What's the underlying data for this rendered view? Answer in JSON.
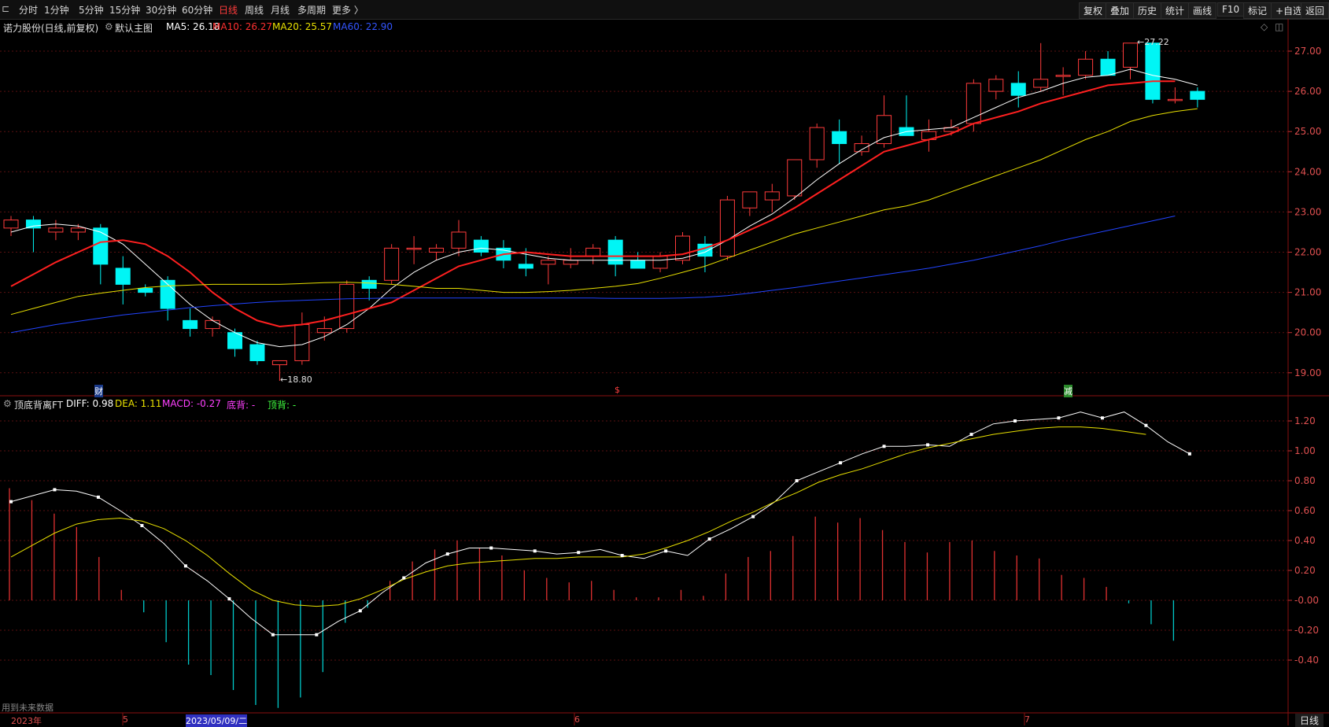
{
  "toolbar": {
    "periods": [
      "分时",
      "1分钟",
      "5分钟",
      "15分钟",
      "30分钟",
      "60分钟",
      "日线",
      "周线",
      "月线",
      "多周期",
      "更多 〉"
    ],
    "active_period": "日线",
    "right_buttons": [
      "复权",
      "叠加",
      "历史",
      "统计",
      "画线",
      "F10",
      "标记",
      "+自选",
      "返回"
    ]
  },
  "main_chart": {
    "stock_title": "诺力股份(日线,前复权)",
    "template_label": "默认主图",
    "indicators": [
      {
        "label": "MA5: 26.18",
        "color": "#ffffff"
      },
      {
        "label": "MA10: 26.27",
        "color": "#ff3030"
      },
      {
        "label": "MA20: 25.57",
        "color": "#e8e000"
      },
      {
        "label": "MA60: 22.90",
        "color": "#3355ff"
      }
    ],
    "high_marker": "27.22",
    "low_marker": "18.80",
    "event_markers": [
      "财",
      "$",
      "减"
    ]
  },
  "sub_chart": {
    "indicator_name": "顶底背离FT",
    "values": [
      {
        "label": "DIFF: 0.98",
        "color": "#ffffff"
      },
      {
        "label": "DEA: 1.11",
        "color": "#e8e000"
      },
      {
        "label": "MACD: -0.27",
        "color": "#ff40ff"
      },
      {
        "label": "底背: -",
        "color": "#ff40ff"
      },
      {
        "label": "顶背: -",
        "color": "#40ff40"
      }
    ]
  },
  "footer": {
    "future_data_label": "用到未来数据",
    "date_labels": [
      "2023年",
      "5",
      "2023/05/09/二",
      "6",
      "7"
    ],
    "period_badge": "日线"
  },
  "chart_data": [
    {
      "type": "candlestick",
      "title": "诺力股份(日线,前复权)",
      "ylim": [
        18.5,
        27.3
      ],
      "y_ticks": [
        19.0,
        20.0,
        21.0,
        22.0,
        23.0,
        24.0,
        25.0,
        26.0,
        27.0
      ],
      "candles": [
        {
          "o": 22.6,
          "h": 22.9,
          "l": 22.4,
          "c": 22.8
        },
        {
          "o": 22.8,
          "h": 22.9,
          "l": 22.0,
          "c": 22.6
        },
        {
          "o": 22.5,
          "h": 22.8,
          "l": 22.3,
          "c": 22.6
        },
        {
          "o": 22.5,
          "h": 22.7,
          "l": 22.3,
          "c": 22.6
        },
        {
          "o": 22.6,
          "h": 22.7,
          "l": 21.2,
          "c": 21.7
        },
        {
          "o": 21.6,
          "h": 21.9,
          "l": 20.7,
          "c": 21.2
        },
        {
          "o": 21.1,
          "h": 21.2,
          "l": 20.9,
          "c": 21.0
        },
        {
          "o": 21.3,
          "h": 21.4,
          "l": 20.3,
          "c": 20.6
        },
        {
          "o": 20.3,
          "h": 20.6,
          "l": 19.9,
          "c": 20.1
        },
        {
          "o": 20.1,
          "h": 20.4,
          "l": 19.9,
          "c": 20.3
        },
        {
          "o": 20.0,
          "h": 20.1,
          "l": 19.4,
          "c": 19.6
        },
        {
          "o": 19.7,
          "h": 19.8,
          "l": 19.2,
          "c": 19.3
        },
        {
          "o": 19.2,
          "h": 19.3,
          "l": 18.8,
          "c": 19.3
        },
        {
          "o": 19.3,
          "h": 20.5,
          "l": 19.2,
          "c": 20.2
        },
        {
          "o": 20.0,
          "h": 20.4,
          "l": 19.8,
          "c": 20.1
        },
        {
          "o": 20.1,
          "h": 21.3,
          "l": 20.0,
          "c": 21.2
        },
        {
          "o": 21.3,
          "h": 21.4,
          "l": 20.8,
          "c": 21.1
        },
        {
          "o": 21.3,
          "h": 22.2,
          "l": 21.2,
          "c": 22.1
        },
        {
          "o": 22.1,
          "h": 22.4,
          "l": 21.7,
          "c": 22.1
        },
        {
          "o": 22.0,
          "h": 22.2,
          "l": 21.8,
          "c": 22.1
        },
        {
          "o": 22.1,
          "h": 22.8,
          "l": 21.9,
          "c": 22.5
        },
        {
          "o": 22.3,
          "h": 22.4,
          "l": 21.9,
          "c": 22.0
        },
        {
          "o": 22.1,
          "h": 22.3,
          "l": 21.6,
          "c": 21.8
        },
        {
          "o": 21.7,
          "h": 22.1,
          "l": 21.4,
          "c": 21.6
        },
        {
          "o": 21.7,
          "h": 21.9,
          "l": 21.2,
          "c": 21.8
        },
        {
          "o": 21.7,
          "h": 22.1,
          "l": 21.6,
          "c": 21.8
        },
        {
          "o": 21.9,
          "h": 22.2,
          "l": 21.7,
          "c": 22.1
        },
        {
          "o": 22.3,
          "h": 22.4,
          "l": 21.4,
          "c": 21.7
        },
        {
          "o": 21.8,
          "h": 22.0,
          "l": 21.6,
          "c": 21.6
        },
        {
          "o": 21.6,
          "h": 22.0,
          "l": 21.5,
          "c": 21.9
        },
        {
          "o": 21.8,
          "h": 22.5,
          "l": 21.7,
          "c": 22.4
        },
        {
          "o": 22.2,
          "h": 22.4,
          "l": 21.5,
          "c": 21.9
        },
        {
          "o": 21.9,
          "h": 23.4,
          "l": 21.8,
          "c": 23.3
        },
        {
          "o": 23.1,
          "h": 23.5,
          "l": 22.9,
          "c": 23.5
        },
        {
          "o": 23.3,
          "h": 23.7,
          "l": 23.0,
          "c": 23.5
        },
        {
          "o": 23.4,
          "h": 24.3,
          "l": 23.3,
          "c": 24.3
        },
        {
          "o": 24.3,
          "h": 25.2,
          "l": 24.1,
          "c": 25.1
        },
        {
          "o": 25.0,
          "h": 25.3,
          "l": 24.2,
          "c": 24.7
        },
        {
          "o": 24.5,
          "h": 24.9,
          "l": 24.4,
          "c": 24.7
        },
        {
          "o": 24.7,
          "h": 25.9,
          "l": 24.6,
          "c": 25.4
        },
        {
          "o": 25.1,
          "h": 25.9,
          "l": 24.9,
          "c": 24.9
        },
        {
          "o": 24.8,
          "h": 25.3,
          "l": 24.5,
          "c": 25.0
        },
        {
          "o": 25.0,
          "h": 25.3,
          "l": 24.9,
          "c": 25.1
        },
        {
          "o": 25.2,
          "h": 26.3,
          "l": 25.0,
          "c": 26.2
        },
        {
          "o": 26.0,
          "h": 26.4,
          "l": 25.8,
          "c": 26.3
        },
        {
          "o": 26.2,
          "h": 26.5,
          "l": 25.6,
          "c": 25.9
        },
        {
          "o": 26.1,
          "h": 27.2,
          "l": 26.0,
          "c": 26.3
        },
        {
          "o": 26.4,
          "h": 26.6,
          "l": 25.9,
          "c": 26.4
        },
        {
          "o": 26.4,
          "h": 27.0,
          "l": 26.3,
          "c": 26.8
        },
        {
          "o": 26.8,
          "h": 27.0,
          "l": 26.4,
          "c": 26.4
        },
        {
          "o": 26.6,
          "h": 27.2,
          "l": 26.3,
          "c": 27.2
        },
        {
          "o": 27.2,
          "h": 27.2,
          "l": 25.7,
          "c": 25.8
        },
        {
          "o": 25.8,
          "h": 26.1,
          "l": 25.7,
          "c": 25.8
        },
        {
          "o": 26.0,
          "h": 26.1,
          "l": 25.6,
          "c": 25.8
        }
      ],
      "series": [
        {
          "name": "MA5",
          "color": "#ffffff",
          "width": 1,
          "values": [
            22.5,
            22.65,
            22.7,
            22.65,
            22.5,
            22.2,
            21.7,
            21.2,
            20.7,
            20.3,
            20.0,
            19.75,
            19.65,
            19.7,
            19.9,
            20.2,
            20.6,
            21.1,
            21.5,
            21.8,
            22.0,
            22.1,
            22.05,
            21.95,
            21.85,
            21.8,
            21.8,
            21.8,
            21.8,
            21.8,
            21.85,
            22.0,
            22.3,
            22.65,
            22.95,
            23.35,
            23.8,
            24.2,
            24.55,
            24.85,
            25.0,
            25.05,
            25.1,
            25.35,
            25.6,
            25.85,
            26.0,
            26.2,
            26.35,
            26.4,
            26.55,
            26.4,
            26.3,
            26.15
          ]
        },
        {
          "name": "MA10",
          "color": "#ff2020",
          "width": 2,
          "values": [
            21.15,
            21.45,
            21.75,
            22.0,
            22.25,
            22.3,
            22.2,
            21.9,
            21.5,
            21.0,
            20.6,
            20.3,
            20.15,
            20.2,
            20.3,
            20.45,
            20.6,
            20.75,
            21.05,
            21.35,
            21.65,
            21.8,
            21.95,
            22.0,
            21.95,
            21.9,
            21.9,
            21.9,
            21.9,
            21.9,
            21.95,
            22.1,
            22.3,
            22.55,
            22.8,
            23.1,
            23.45,
            23.8,
            24.15,
            24.5,
            24.65,
            24.8,
            24.95,
            25.2,
            25.35,
            25.5,
            25.7,
            25.85,
            26.0,
            26.15,
            26.2,
            26.25,
            26.25
          ]
        },
        {
          "name": "MA20",
          "color": "#e8e000",
          "width": 1,
          "values": [
            20.45,
            20.6,
            20.75,
            20.9,
            20.98,
            21.05,
            21.12,
            21.16,
            21.18,
            21.2,
            21.2,
            21.2,
            21.2,
            21.22,
            21.24,
            21.25,
            21.23,
            21.2,
            21.15,
            21.1,
            21.1,
            21.05,
            21.0,
            21.0,
            21.02,
            21.05,
            21.1,
            21.15,
            21.22,
            21.35,
            21.5,
            21.65,
            21.85,
            22.05,
            22.25,
            22.45,
            22.6,
            22.75,
            22.9,
            23.05,
            23.15,
            23.3,
            23.5,
            23.7,
            23.9,
            24.1,
            24.3,
            24.55,
            24.8,
            25.0,
            25.25,
            25.4,
            25.5,
            25.57
          ]
        },
        {
          "name": "MA60",
          "color": "#2244ff",
          "width": 1,
          "values": [
            20.0,
            20.1,
            20.2,
            20.28,
            20.36,
            20.44,
            20.5,
            20.56,
            20.62,
            20.67,
            20.71,
            20.75,
            20.78,
            20.8,
            20.82,
            20.84,
            20.85,
            20.86,
            20.86,
            20.86,
            20.86,
            20.86,
            20.86,
            20.86,
            20.86,
            20.86,
            20.86,
            20.85,
            20.85,
            20.85,
            20.86,
            20.88,
            20.92,
            20.98,
            21.05,
            21.12,
            21.2,
            21.28,
            21.36,
            21.44,
            21.52,
            21.6,
            21.7,
            21.8,
            21.92,
            22.04,
            22.16,
            22.3,
            22.42,
            22.54,
            22.66,
            22.78,
            22.9
          ]
        }
      ]
    },
    {
      "type": "bar",
      "title": "顶底背离FT",
      "ylim": [
        -0.6,
        1.4
      ],
      "y_ticks": [
        1.2,
        1.0,
        0.8,
        0.6,
        0.4,
        0.2,
        0.0,
        -0.2,
        -0.4
      ],
      "y_tick_labels": [
        "1.20",
        "1.00",
        "0.80",
        "0.60",
        "0.40",
        "0.20",
        "-0.00",
        "-0.20",
        "-0.40"
      ],
      "macd_hist": [
        0.75,
        0.67,
        0.58,
        0.49,
        0.29,
        0.07,
        -0.08,
        -0.28,
        -0.43,
        -0.5,
        -0.6,
        -0.7,
        -0.72,
        -0.65,
        -0.48,
        -0.15,
        -0.05,
        0.13,
        0.26,
        0.34,
        0.4,
        0.35,
        0.3,
        0.2,
        0.15,
        0.12,
        0.13,
        0.07,
        0.02,
        0.02,
        0.07,
        0.03,
        0.18,
        0.29,
        0.33,
        0.43,
        0.56,
        0.52,
        0.55,
        0.47,
        0.39,
        0.32,
        0.39,
        0.4,
        0.33,
        0.3,
        0.28,
        0.17,
        0.15,
        0.09,
        -0.02,
        -0.16,
        -0.27
      ],
      "series": [
        {
          "name": "DIFF",
          "color": "#ffffff",
          "values": [
            0.66,
            0.7,
            0.74,
            0.73,
            0.69,
            0.6,
            0.5,
            0.38,
            0.23,
            0.13,
            0.01,
            -0.12,
            -0.23,
            -0.23,
            -0.23,
            -0.14,
            -0.07,
            0.05,
            0.15,
            0.25,
            0.31,
            0.35,
            0.35,
            0.34,
            0.33,
            0.31,
            0.32,
            0.34,
            0.3,
            0.28,
            0.33,
            0.3,
            0.41,
            0.48,
            0.56,
            0.66,
            0.8,
            0.86,
            0.92,
            0.98,
            1.03,
            1.03,
            1.04,
            1.03,
            1.11,
            1.18,
            1.2,
            1.21,
            1.22,
            1.26,
            1.22,
            1.26,
            1.17,
            1.06,
            0.98
          ]
        },
        {
          "name": "DEA",
          "color": "#e8e000",
          "values": [
            0.29,
            0.37,
            0.45,
            0.51,
            0.54,
            0.55,
            0.53,
            0.48,
            0.4,
            0.3,
            0.18,
            0.07,
            0.0,
            -0.03,
            -0.04,
            -0.03,
            0.01,
            0.07,
            0.14,
            0.19,
            0.23,
            0.25,
            0.26,
            0.27,
            0.28,
            0.28,
            0.29,
            0.29,
            0.29,
            0.31,
            0.35,
            0.4,
            0.46,
            0.53,
            0.59,
            0.66,
            0.72,
            0.79,
            0.84,
            0.88,
            0.93,
            0.98,
            1.02,
            1.05,
            1.08,
            1.11,
            1.13,
            1.15,
            1.16,
            1.16,
            1.15,
            1.13,
            1.11
          ]
        }
      ]
    }
  ]
}
